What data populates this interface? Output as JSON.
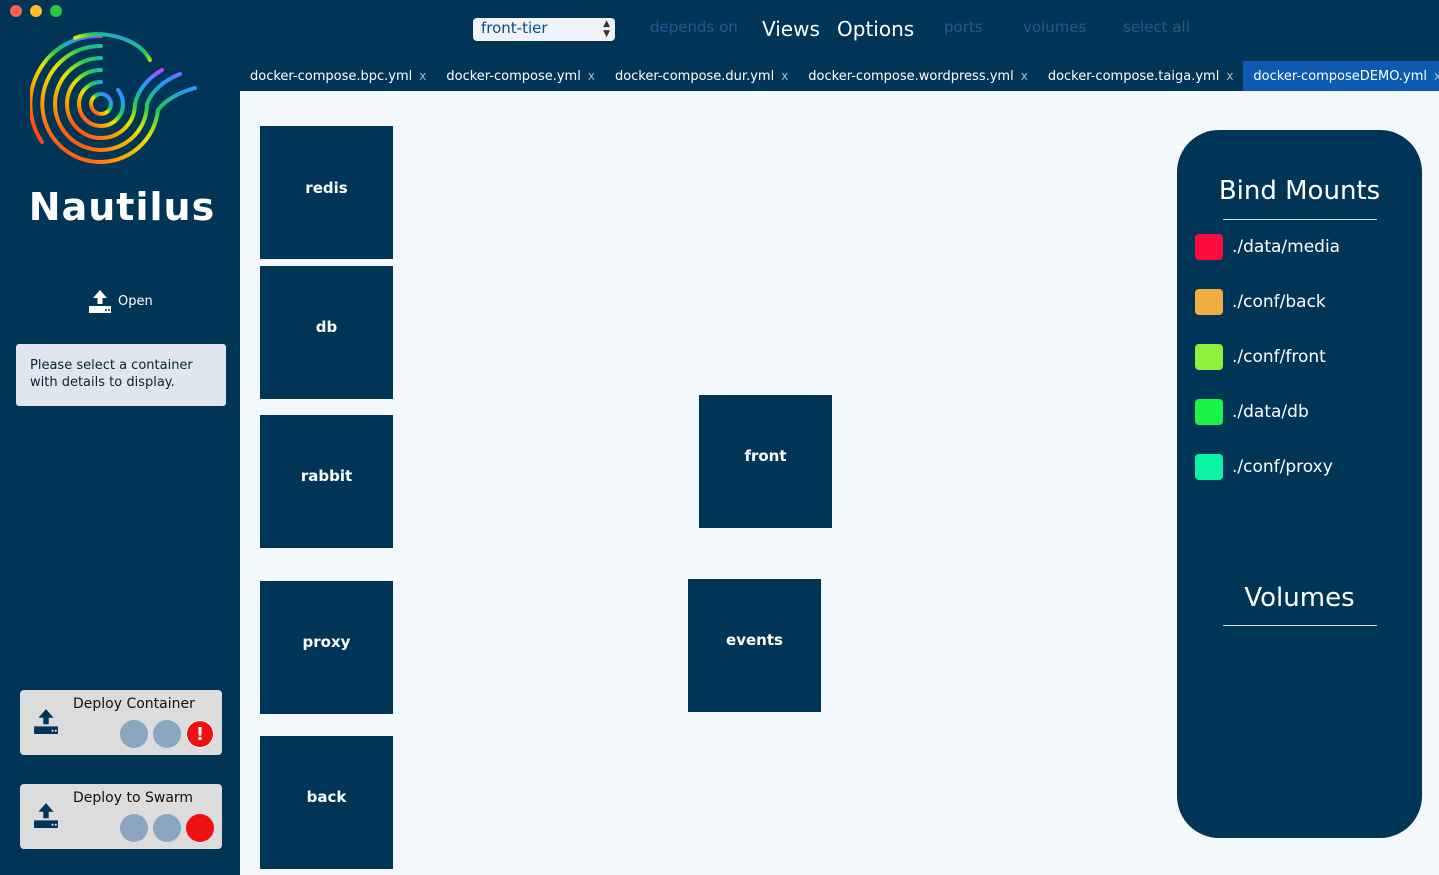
{
  "app": {
    "name": "Nautilus"
  },
  "sidebar": {
    "open_label": "Open",
    "details_text": "Please select a container with details to display.",
    "deploy_container_label": "Deploy Container",
    "deploy_swarm_label": "Deploy to Swarm",
    "error_mark": "!"
  },
  "toolbar": {
    "network_select_value": "front-tier",
    "depends_on": "depends on",
    "views": "Views",
    "options": "Options",
    "ports": "ports",
    "volumes": "volumes",
    "select_all": "select all"
  },
  "tabs": [
    {
      "label": "docker-compose.bpc.yml",
      "close": "x"
    },
    {
      "label": "docker-compose.yml",
      "close": "x"
    },
    {
      "label": "docker-compose.dur.yml",
      "close": "x"
    },
    {
      "label": "docker-compose.wordpress.yml",
      "close": "x"
    },
    {
      "label": "docker-compose.taiga.yml",
      "close": "x"
    },
    {
      "label": "docker-composeDEMO.yml",
      "close": "x",
      "active": true
    }
  ],
  "services": [
    "redis",
    "db",
    "rabbit",
    "proxy",
    "back",
    "front",
    "events"
  ],
  "panel": {
    "bind_mounts_title": "Bind Mounts",
    "volumes_title": "Volumes",
    "bind_mounts": [
      {
        "path": "./data/media",
        "color": "#fe0a3c"
      },
      {
        "path": "./conf/back",
        "color": "#efae3e"
      },
      {
        "path": "./conf/front",
        "color": "#90f03e"
      },
      {
        "path": "./data/db",
        "color": "#19f446"
      },
      {
        "path": "./conf/proxy",
        "color": "#0af4a8"
      }
    ]
  },
  "colors": {
    "background": "#013558",
    "canvas": "#f3f8fc",
    "active_tab": "#0c5bb0"
  }
}
